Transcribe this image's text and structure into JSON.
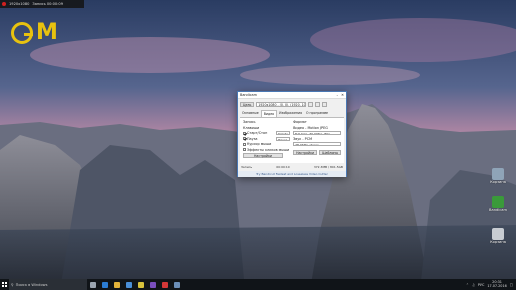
{
  "recorder_bar": {
    "resolution": "1920x1080",
    "status": "Запись 00:00:09"
  },
  "logo": {
    "text": "M"
  },
  "desktop_icons": [
    {
      "name": "recycle-bin-icon",
      "label": "Корзина",
      "color": "#8fa4b8"
    },
    {
      "name": "bandicam-shortcut-icon",
      "label": "Bandicam",
      "color": "#3a9a3a"
    },
    {
      "name": "trash-icon",
      "label": "Корзина",
      "color": "#c8ccd2"
    }
  ],
  "window": {
    "title": "Bandicam",
    "area_button": "Цель",
    "resolution": "1920x1080 - (0, 0), (1920, 1080)",
    "tabs": [
      "Основные",
      "Видео",
      "Изображения",
      "О программе"
    ],
    "active_tab": 1,
    "left": {
      "section": "Запись",
      "hotkey_label": "Клавиши",
      "checks": [
        {
          "label": "Старт/Стоп",
          "value": "Delete",
          "on": true
        },
        {
          "label": "Пауза",
          "value": "Пауза",
          "on": true
        }
      ],
      "cursor_checks": [
        {
          "label": "Курсор мыши",
          "on": false
        },
        {
          "label": "Эффекты кликов мыши",
          "on": false
        }
      ],
      "settings_button": "Настройки"
    },
    "right": {
      "section": "Формат",
      "video_label": "Видео - Motion JPEG",
      "video_value": "Full Size, 30.00fps, 80q",
      "audio_label": "Звук - PCM",
      "audio_value": "48.0KHz, stereo",
      "settings_button": "Настройки",
      "presets_button": "Шаблоны"
    },
    "status_left": "Запись",
    "status_time": "00:00:10",
    "status_size": "372.3MB / 801.5GB",
    "footer": "Try Bandicut Fastest and Losseless Video Cutter"
  },
  "taskbar": {
    "search_placeholder": "Поиск в Windows",
    "apps": [
      {
        "name": "task-view-icon",
        "color": "#9aa4b0"
      },
      {
        "name": "edge-icon",
        "color": "#2b7cd3"
      },
      {
        "name": "explorer-icon",
        "color": "#e2b33b"
      },
      {
        "name": "store-icon",
        "color": "#4a8fd8"
      },
      {
        "name": "chrome-icon",
        "color": "#d8c23c"
      },
      {
        "name": "vs-icon",
        "color": "#7a4fbf"
      },
      {
        "name": "bandicam-taskbar-icon",
        "color": "#d33838"
      },
      {
        "name": "app-icon",
        "color": "#6b8fb8"
      }
    ],
    "lang": "РУС",
    "time": "20:31",
    "date": "17.07.2016"
  }
}
